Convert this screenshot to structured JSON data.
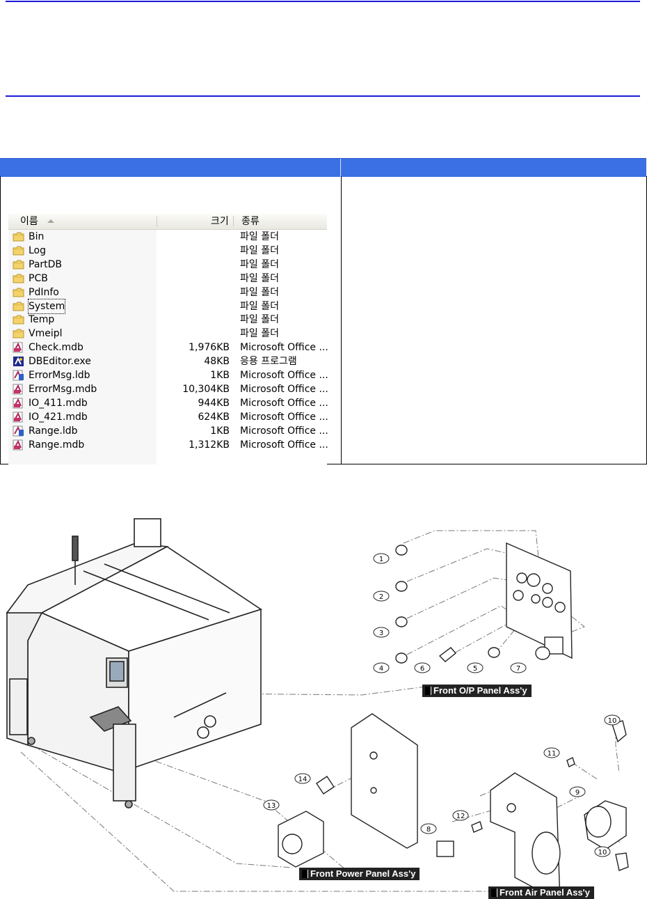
{
  "explorer": {
    "columns": {
      "name": "이름",
      "size": "크기",
      "type": "종류"
    },
    "rows": [
      {
        "name": "Bin",
        "size": "",
        "type": "파일 폴더",
        "icon": "folder-icon"
      },
      {
        "name": "Log",
        "size": "",
        "type": "파일 폴더",
        "icon": "folder-icon"
      },
      {
        "name": "PartDB",
        "size": "",
        "type": "파일 폴더",
        "icon": "folder-icon"
      },
      {
        "name": "PCB",
        "size": "",
        "type": "파일 폴더",
        "icon": "folder-icon"
      },
      {
        "name": "PdInfo",
        "size": "",
        "type": "파일 폴더",
        "icon": "folder-icon"
      },
      {
        "name": "System",
        "size": "",
        "type": "파일 폴더",
        "icon": "folder-icon"
      },
      {
        "name": "Temp",
        "size": "",
        "type": "파일 폴더",
        "icon": "folder-icon"
      },
      {
        "name": "Vmeipl",
        "size": "",
        "type": "파일 폴더",
        "icon": "folder-icon"
      },
      {
        "name": "Check.mdb",
        "size": "1,976KB",
        "type": "Microsoft Office ...",
        "icon": "access-db-icon"
      },
      {
        "name": "DBEditor.exe",
        "size": "48KB",
        "type": "응용 프로그램",
        "icon": "application-icon"
      },
      {
        "name": "ErrorMsg.ldb",
        "size": "1KB",
        "type": "Microsoft Office ...",
        "icon": "access-lock-icon"
      },
      {
        "name": "ErrorMsg.mdb",
        "size": "10,304KB",
        "type": "Microsoft Office ...",
        "icon": "access-db-icon"
      },
      {
        "name": "IO_411.mdb",
        "size": "944KB",
        "type": "Microsoft Office ...",
        "icon": "access-db-icon"
      },
      {
        "name": "IO_421.mdb",
        "size": "624KB",
        "type": "Microsoft Office ...",
        "icon": "access-db-icon"
      },
      {
        "name": "Range.ldb",
        "size": "1KB",
        "type": "Microsoft Office ...",
        "icon": "access-lock-icon"
      },
      {
        "name": "Range.mdb",
        "size": "1,312KB",
        "type": "Microsoft Office ...",
        "icon": "access-db-icon"
      }
    ]
  },
  "diagram": {
    "labels": {
      "front_op": "Front  O/P  Panel  Ass'y",
      "front_power": "Front  Power  Panel  Ass'y",
      "front_air": "Front  Air  Panel  Ass'y"
    },
    "callouts": [
      "1",
      "2",
      "3",
      "4",
      "5",
      "6",
      "7",
      "8",
      "9",
      "10",
      "10",
      "11",
      "12",
      "13",
      "14"
    ]
  },
  "colors": {
    "rule": "#1a1ad8",
    "table_header": "#3b6fe4"
  }
}
